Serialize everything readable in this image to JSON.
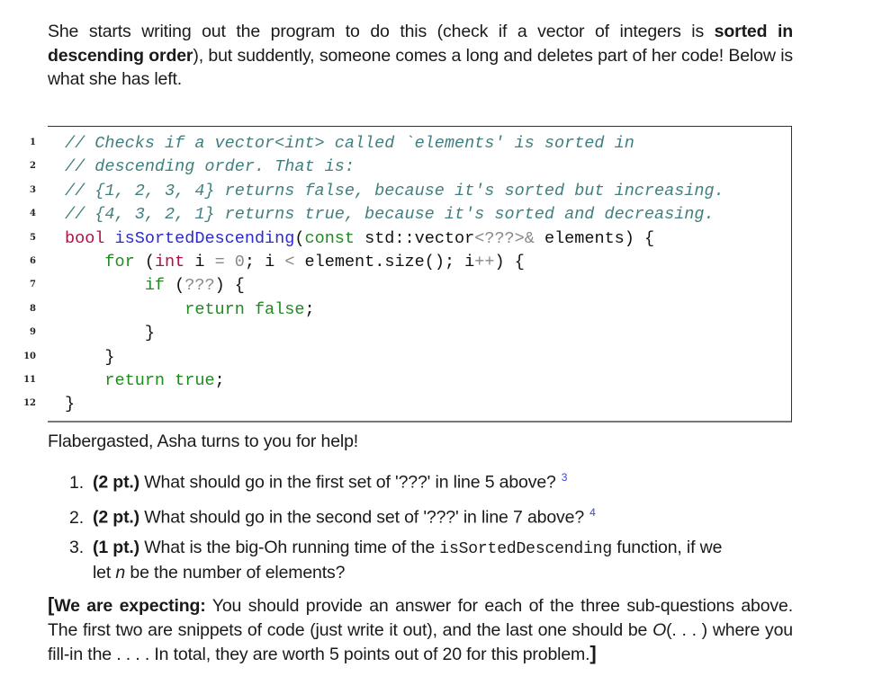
{
  "intro": {
    "part1": "She starts writing out the program to do this (check if a vector of integers is ",
    "bold": "sorted in descending order",
    "part2": "), but suddently, someone comes a long and deletes part of her code! Below is what she has left."
  },
  "code": {
    "lines": [
      {
        "n": "1",
        "tokens": [
          {
            "t": "// Checks if a vector<int> called `elements' is sorted in",
            "c": "comment"
          }
        ]
      },
      {
        "n": "2",
        "tokens": [
          {
            "t": "// descending order. That is:",
            "c": "comment"
          }
        ]
      },
      {
        "n": "3",
        "tokens": [
          {
            "t": "// {1, 2, 3, 4} returns false, because it's sorted but increasing.",
            "c": "comment"
          }
        ]
      },
      {
        "n": "4",
        "tokens": [
          {
            "t": "// {4, 3, 2, 1} returns true, because it's sorted and decreasing.",
            "c": "comment"
          }
        ]
      },
      {
        "n": "5",
        "tokens": [
          {
            "t": "bool",
            "c": "type"
          },
          {
            "t": " ",
            "c": "plain"
          },
          {
            "t": "isSortedDescending",
            "c": "func"
          },
          {
            "t": "(",
            "c": "plain"
          },
          {
            "t": "const",
            "c": "kw"
          },
          {
            "t": " std::vector",
            "c": "plain"
          },
          {
            "t": "<???>&",
            "c": "dim"
          },
          {
            "t": " elements) {",
            "c": "plain"
          }
        ]
      },
      {
        "n": "6",
        "tokens": [
          {
            "t": "    ",
            "c": "plain"
          },
          {
            "t": "for",
            "c": "kw"
          },
          {
            "t": " (",
            "c": "plain"
          },
          {
            "t": "int",
            "c": "type"
          },
          {
            "t": " i ",
            "c": "plain"
          },
          {
            "t": "=",
            "c": "dim"
          },
          {
            "t": " ",
            "c": "plain"
          },
          {
            "t": "0",
            "c": "dim"
          },
          {
            "t": "; i ",
            "c": "plain"
          },
          {
            "t": "<",
            "c": "dim"
          },
          {
            "t": " element.size(); i",
            "c": "plain"
          },
          {
            "t": "++",
            "c": "dim"
          },
          {
            "t": ") {",
            "c": "plain"
          }
        ]
      },
      {
        "n": "7",
        "tokens": [
          {
            "t": "        ",
            "c": "plain"
          },
          {
            "t": "if",
            "c": "kw"
          },
          {
            "t": " (",
            "c": "plain"
          },
          {
            "t": "???",
            "c": "dim"
          },
          {
            "t": ") {",
            "c": "plain"
          }
        ]
      },
      {
        "n": "8",
        "tokens": [
          {
            "t": "            ",
            "c": "plain"
          },
          {
            "t": "return false",
            "c": "kw"
          },
          {
            "t": ";",
            "c": "plain"
          }
        ]
      },
      {
        "n": "9",
        "tokens": [
          {
            "t": "        }",
            "c": "plain"
          }
        ]
      },
      {
        "n": "10",
        "tokens": [
          {
            "t": "    }",
            "c": "plain"
          }
        ]
      },
      {
        "n": "11",
        "tokens": [
          {
            "t": "    ",
            "c": "plain"
          },
          {
            "t": "return true",
            "c": "kw"
          },
          {
            "t": ";",
            "c": "plain"
          }
        ]
      },
      {
        "n": "12",
        "tokens": [
          {
            "t": "}",
            "c": "plain"
          }
        ]
      }
    ]
  },
  "after": {
    "flabbergasted": "Flabergasted, Asha turns to you for help!",
    "questions": [
      {
        "num": "1.",
        "points": "(2 pt.)",
        "text": " What should go in the first set of '???' in line 5 above?",
        "footnote": "3"
      },
      {
        "num": "2.",
        "points": "(2 pt.)",
        "text": " What should go in the second set of '???' in line 7 above?",
        "footnote": "4"
      },
      {
        "num": "3.",
        "points": "(1 pt.)",
        "text_a": " What is the big-Oh running time of the ",
        "code": "isSortedDescending",
        "text_b": " function, if we",
        "cont_a": "let ",
        "cont_var": "n",
        "cont_b": " be the number of elements?"
      }
    ]
  },
  "expecting": {
    "open_bracket": "[",
    "label": "We are expecting:",
    "text1": " You should provide an answer for each of the three sub-questions above. The first two are snippets of code (just write it out), and the last one should be ",
    "bigo": "O",
    "text2": "(. . . ) where you fill-in the . . . . In total, they are worth 5 points out of 20 for this problem.",
    "close_bracket": "]"
  }
}
